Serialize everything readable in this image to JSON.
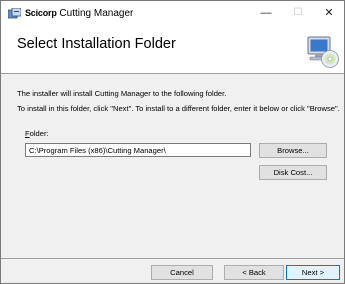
{
  "window": {
    "brand": "Scicorp",
    "title": "Cutting Manager",
    "minimize_glyph": "—",
    "maximize_glyph": "☐",
    "close_glyph": "✕"
  },
  "banner": {
    "title": "Select Installation Folder",
    "icon": "computer-cd-icon"
  },
  "body": {
    "line1": "The installer will install Cutting Manager to the following folder.",
    "line2": "To install in this folder, click \"Next\". To install to a different folder, enter it below or click \"Browse\"."
  },
  "folder": {
    "label_accel": "F",
    "label_rest": "older:",
    "value": "C:\\Program Files (x86)\\Cutting Manager\\"
  },
  "buttons": {
    "browse": "Browse...",
    "disk_cost": "Disk Cost...",
    "cancel": "Cancel",
    "back": "< Back",
    "next": "Next >"
  },
  "colors": {
    "default_button_border": "#0078d7",
    "dialog_background": "#f0f0f0"
  }
}
